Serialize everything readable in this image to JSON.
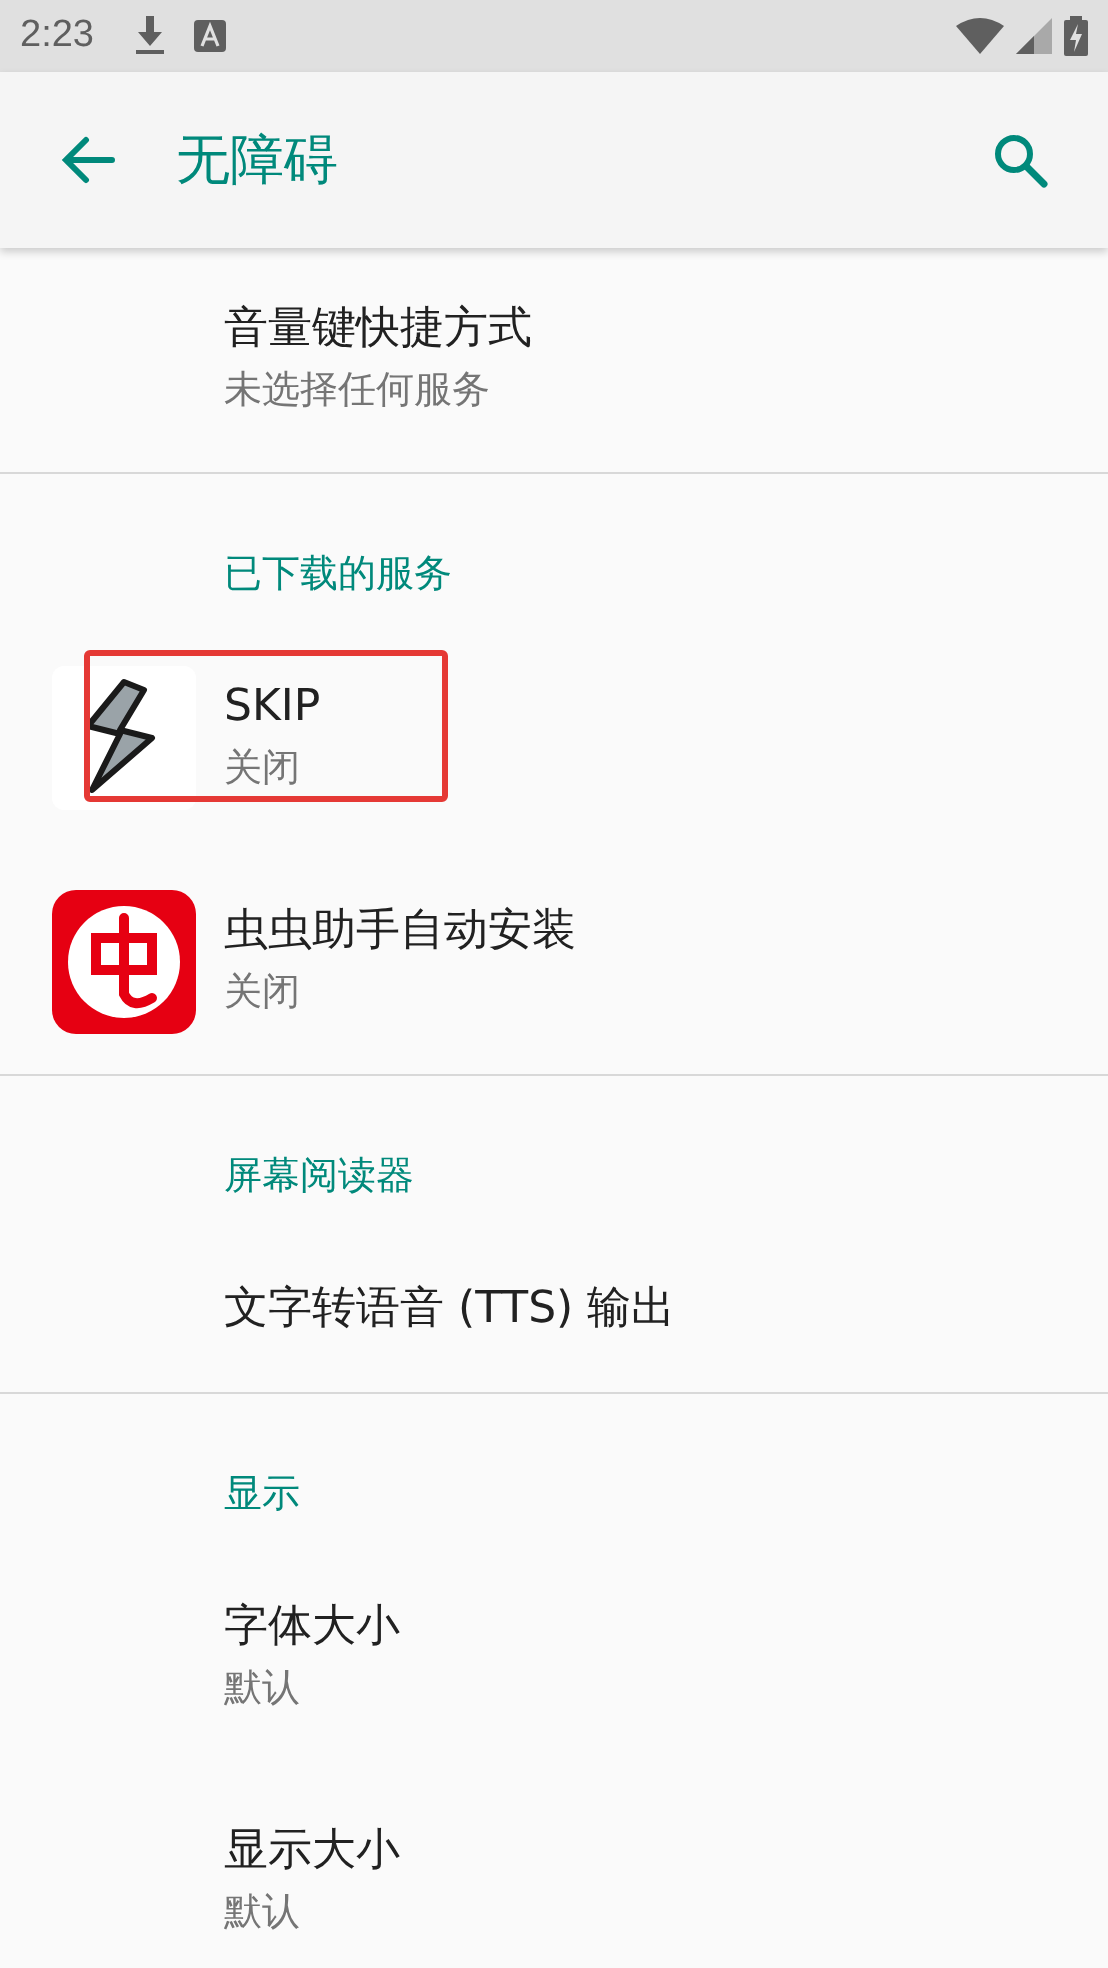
{
  "status_bar": {
    "time": "2:23"
  },
  "toolbar": {
    "title": "无障碍"
  },
  "sections": [
    {
      "items": [
        {
          "kind": "text",
          "title": "音量键快捷方式",
          "subtitle": "未选择任何服务"
        }
      ]
    },
    {
      "header": "已下载的服务",
      "items": [
        {
          "kind": "app",
          "title": "SKIP",
          "subtitle": "关闭",
          "highlighted": true
        },
        {
          "kind": "app",
          "title": "虫虫助手自动安装",
          "subtitle": "关闭",
          "highlighted": false
        }
      ]
    },
    {
      "header": "屏幕阅读器",
      "items": [
        {
          "kind": "text",
          "title": "文字转语音 (TTS) 输出"
        }
      ]
    },
    {
      "header": "显示",
      "items": [
        {
          "kind": "text",
          "title": "字体大小",
          "subtitle": "默认"
        },
        {
          "kind": "text",
          "title": "显示大小",
          "subtitle": "默认"
        }
      ]
    }
  ]
}
